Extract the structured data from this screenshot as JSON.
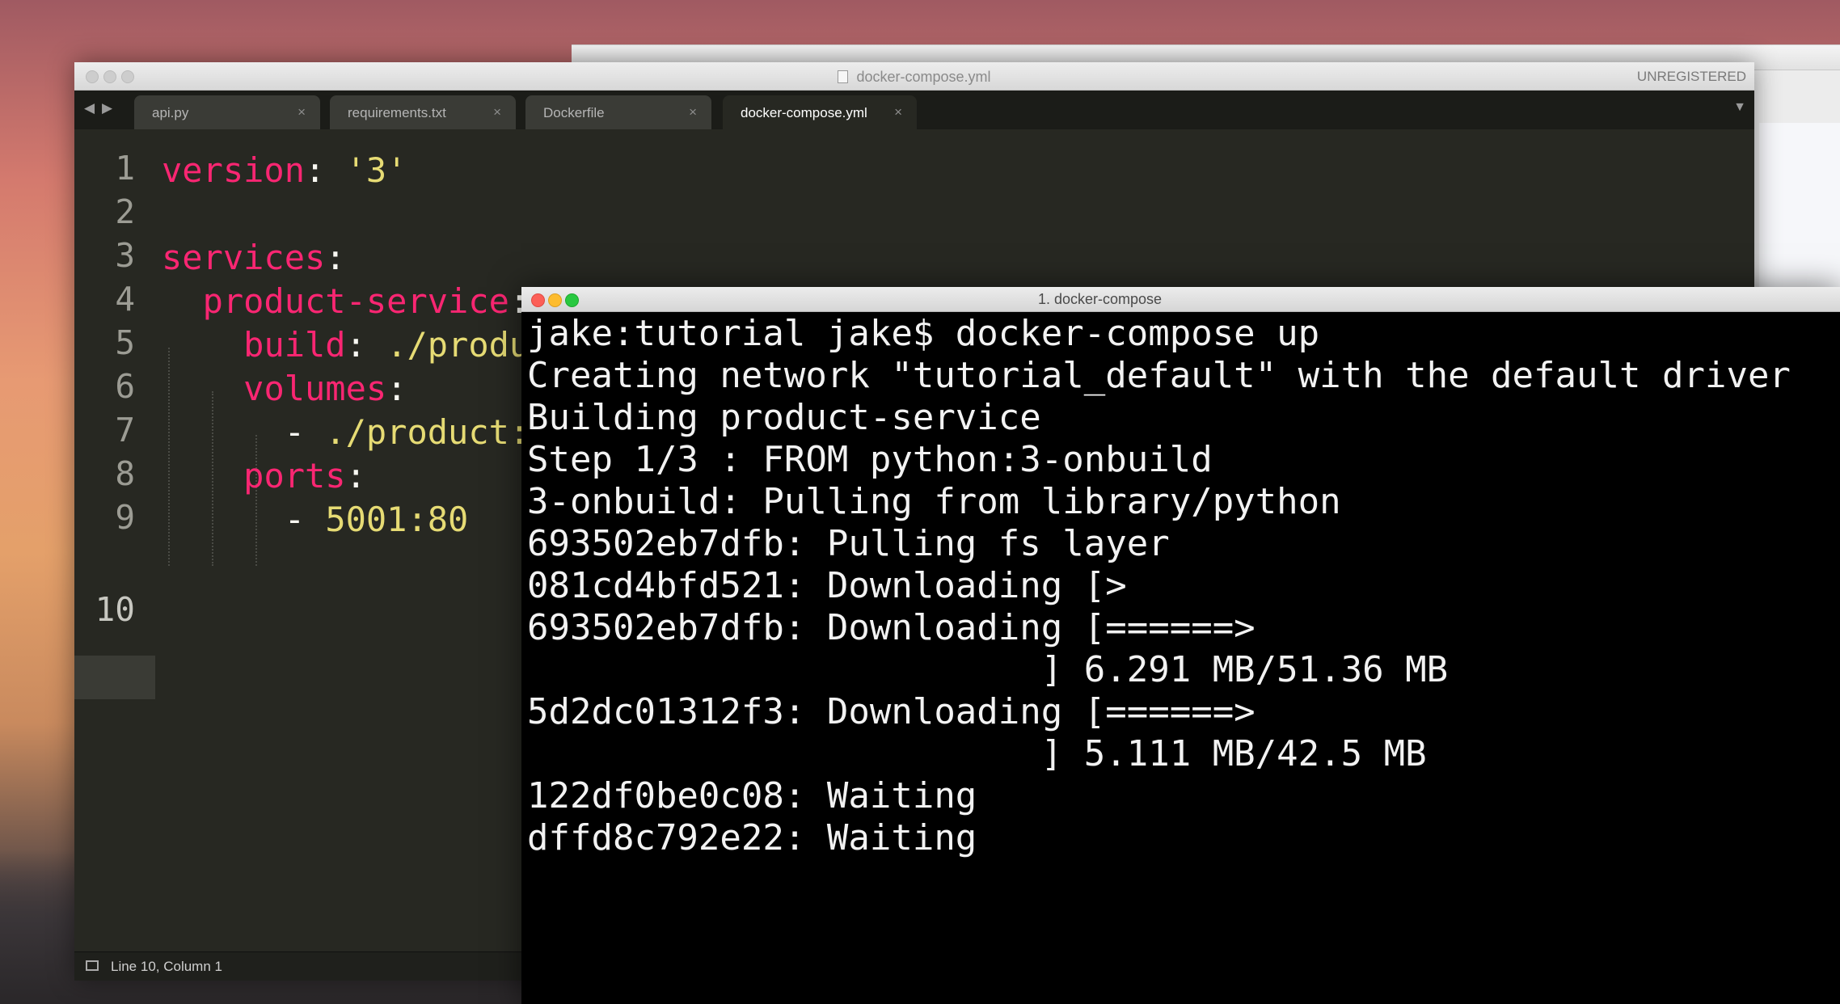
{
  "editor": {
    "title": "docker-compose.yml",
    "registration": "UNREGISTERED",
    "tabs": [
      {
        "label": "api.py",
        "close": "×"
      },
      {
        "label": "requirements.txt",
        "close": "×"
      },
      {
        "label": "Dockerfile",
        "close": "×"
      },
      {
        "label": "docker-compose.yml",
        "close": "×"
      }
    ],
    "nav_back": "◀",
    "nav_forward": "▶",
    "tab_menu": "▼",
    "line_numbers": [
      "1",
      "2",
      "3",
      "4",
      "5",
      "6",
      "7",
      "8",
      "9",
      "10"
    ],
    "code": {
      "l1_key": "version",
      "l1_colon": ":",
      "l1_value": "'3'",
      "l3_key": "services",
      "l3_colon": ":",
      "l4_key": "product-service",
      "l4_colon": ":",
      "l5_key": "build",
      "l5_colon": ":",
      "l5_value": "./product",
      "l6_key": "volumes",
      "l6_colon": ":",
      "l7_dash": "-",
      "l7_value": "./product:/usr/src/app",
      "l8_key": "ports",
      "l8_colon": ":",
      "l9_dash": "-",
      "l9_value": "5001:80"
    },
    "status": "Line 10, Column 1"
  },
  "terminal": {
    "title": "1. docker-compose",
    "lines": [
      "jake:tutorial jake$ docker-compose up",
      "Creating network \"tutorial_default\" with the default driver",
      "Building product-service",
      "Step 1/3 : FROM python:3-onbuild",
      "3-onbuild: Pulling from library/python",
      "693502eb7dfb: Pulling fs layer",
      "081cd4bfd521: Downloading [>",
      "693502eb7dfb: Downloading [======>",
      "                        ] 6.291 MB/51.36 MB",
      "5d2dc01312f3: Downloading [======>",
      "                        ] 5.111 MB/42.5 MB",
      "122df0be0c08: Waiting",
      "dffd8c792e22: Waiting"
    ]
  },
  "colors": {
    "editor_bg": "#272822",
    "keyword": "#f92672",
    "string": "#e6db74",
    "terminal_bg": "#000000",
    "close_light": "#fc5f57",
    "minimize_light": "#fdbc2e",
    "zoom_light": "#28c840"
  }
}
